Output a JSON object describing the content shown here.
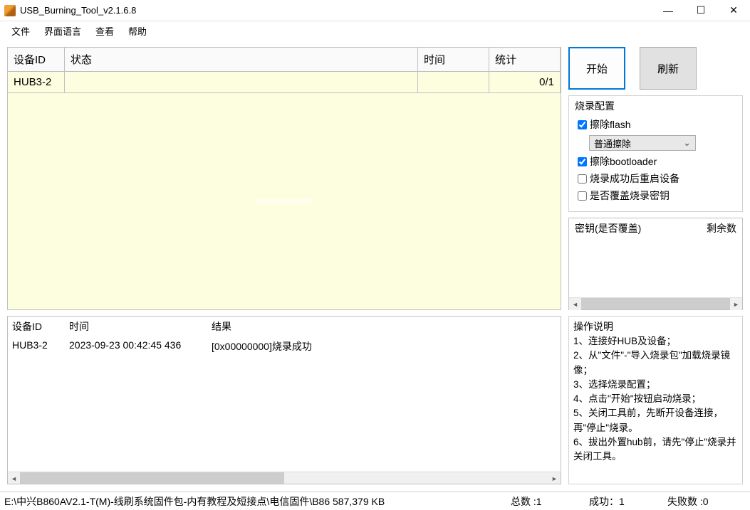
{
  "titlebar": {
    "title": "USB_Burning_Tool_v2.1.6.8"
  },
  "menubar": {
    "file": "文件",
    "language": "界面语言",
    "view": "查看",
    "help": "帮助"
  },
  "device_table": {
    "headers": {
      "device_id": "设备ID",
      "status": "状态",
      "time": "时间",
      "stats": "统计"
    },
    "rows": [
      {
        "device_id": "HUB3-2",
        "status": "",
        "time": "",
        "stats": "0/1"
      }
    ],
    "watermark": ""
  },
  "log_table": {
    "headers": {
      "device_id": "设备ID",
      "time": "时间",
      "result": "结果"
    },
    "rows": [
      {
        "device_id": "HUB3-2",
        "time": "2023-09-23 00:42:45 436",
        "result": "[0x00000000]烧录成功"
      }
    ]
  },
  "buttons": {
    "start": "开始",
    "refresh": "刷新"
  },
  "config_group": {
    "title": "烧录配置",
    "erase_flash": "擦除flash",
    "erase_mode": "普通擦除",
    "erase_bootloader": "擦除bootloader",
    "reboot_after": "烧录成功后重启设备",
    "overwrite_key": "是否覆盖烧录密钥"
  },
  "keys_box": {
    "col1": "密钥(是否覆盖)",
    "col2": "剩余数"
  },
  "instructions": {
    "title": "操作说明",
    "line1": "1、连接好HUB及设备；",
    "line2": "2、从\"文件\"-\"导入烧录包\"加载烧录镜像；",
    "line3": "3、选择烧录配置；",
    "line4": "4、点击\"开始\"按钮启动烧录；",
    "line5": "5、关闭工具前，先断开设备连接，再\"停止\"烧录。",
    "line6": "6、拔出外置hub前，请先\"停止\"烧录并关闭工具。"
  },
  "statusbar": {
    "path": "E:\\中兴B860AV2.1-T(M)-线刷系统固件包-内有教程及短接点\\电信固件\\B86 587,379 KB",
    "total": "总数 :1",
    "success": "成功：1",
    "fail": "失败数 :0"
  }
}
